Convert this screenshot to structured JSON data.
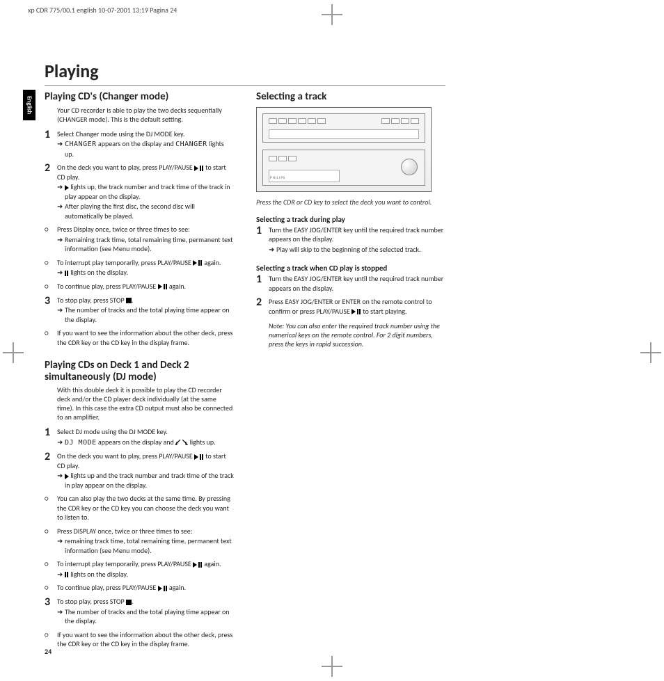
{
  "print_header": "xp CDR 775/00.1 english  10-07-2001 13:19  Pagina 24",
  "side_tab": "English",
  "page_title": "Playing",
  "page_number": "24",
  "left": {
    "sec1": {
      "title": "Playing CD's (Changer mode)",
      "intro": "Your CD recorder is able to play the two decks sequentially (CHANGER mode). This is the default setting.",
      "s1": "Select Changer mode using the DJ MODE key.",
      "s1a_a": "CHANGER",
      "s1a_b": " appears on the display and ",
      "s1a_c": "CHANGER",
      "s1a_d": " lights up.",
      "s2a": "On the deck you want to play, press PLAY/PAUSE ",
      "s2b": " to start CD play.",
      "s2s1": " lights up, the track number and track time of the track in play appear on the display.",
      "s2s2": "After playing the first disc, the second disc will automatically be played.",
      "o1": "Press Display once, twice or three times to see:",
      "o1a": "Remaining track time, total remaining time, permanent text information (see Menu mode).",
      "o2a": "To interrupt play temporarily, press PLAY/PAUSE ",
      "o2b": " again.",
      "o2s": " lights on the display.",
      "o3a": "To continue play, press PLAY/PAUSE ",
      "o3b": " again.",
      "s3a": "To stop play, press STOP ",
      "s3b": ".",
      "s3s": "The number of tracks and the total playing time appear on the display.",
      "o4": "If you want to see the information about the other deck, press the CDR key or the CD key in the display frame."
    },
    "sec2": {
      "title": "Playing CDs on Deck 1 and Deck 2 simultaneously (DJ mode)",
      "intro": "With this double deck it is possible to play the CD recorder deck and/or the CD player deck individually (at the same time). In this case the extra CD output must also be connected to an amplifier.",
      "s1": "Select DJ mode using the DJ MODE key.",
      "s1a_a": "DJ MODE",
      "s1a_b": " appears on the display and ",
      "s1a_c": " lights up.",
      "s2a": "On the deck you want to play, press PLAY/PAUSE ",
      "s2b": " to start CD play.",
      "s2s1": " lights up and the track number and track time of the track in play appear on the display.",
      "o1": "You can also play the two decks at the same time. By pressing the CDR key or the CD key you can choose the deck you want to listen to.",
      "o2": "Press DISPLAY once, twice or three times to see:",
      "o2s": "remaining track time, total remaining time, permanent text information (see Menu mode).",
      "o3a": "To interrupt play temporarily, press PLAY/PAUSE ",
      "o3b": " again.",
      "o3s": " lights on the display.",
      "o4a": "To continue play, press PLAY/PAUSE ",
      "o4b": " again.",
      "s3a": "To stop play, press STOP ",
      "s3b": ".",
      "s3s": "The number of tracks and the total playing time appear on the display.",
      "o5": "If you want to see the information about the other deck, press the CDR key or the CD key in the display frame."
    }
  },
  "right": {
    "title": "Selecting a track",
    "caption": "Press the CDR or CD key to select the deck you want to control.",
    "sub1": "Selecting a track during play",
    "sub1_s1": "Turn the EASY JOG/ENTER key until the required track number appears on the display.",
    "sub1_s1a": "Play will skip to the beginning of the selected track.",
    "sub2": "Selecting a track when CD play is stopped",
    "sub2_s1": "Turn the EASY JOG/ENTER key until the required track number appears on  the display.",
    "sub2_s2a": "Press EASY JOG/ENTER or ENTER on the remote control to confirm or press PLAY/PAUSE ",
    "sub2_s2b": " to start playing.",
    "note": "Note: You can also enter the required track number using the numerical keys on the remote control. For 2 digit numbers, press the keys in rapid succession."
  }
}
